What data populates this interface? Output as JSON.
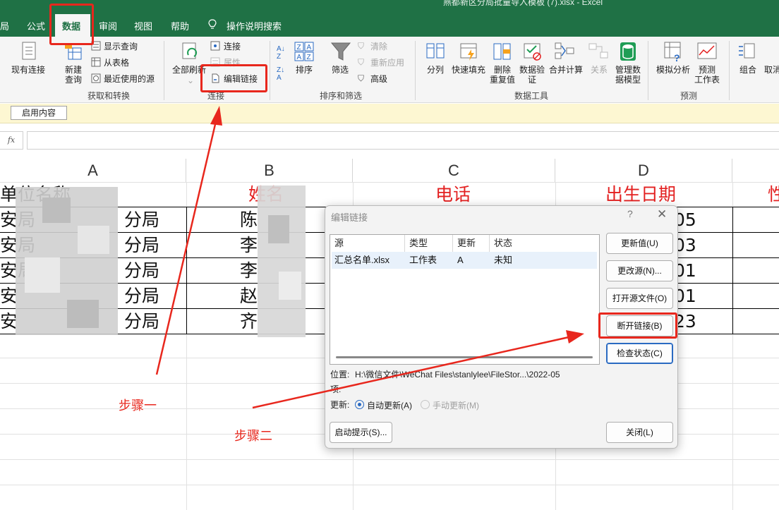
{
  "window": {
    "title": "燕都新区分局批量导入模板 (7).xlsx  -  Excel"
  },
  "menu_tabs": [
    "局",
    "公式",
    "数据",
    "审阅",
    "视图",
    "帮助"
  ],
  "search_label": "操作说明搜索",
  "ribbon": {
    "get_transform": {
      "existing_connections": "现有连接",
      "new_query_1": "新建",
      "new_query_2": "查询",
      "show_queries": "显示查询",
      "from_table": "从表格",
      "recent_sources": "最近使用的源",
      "group_label": "获取和转换"
    },
    "connections": {
      "refresh_all": "全部刷新",
      "connections": "连接",
      "properties": "属性",
      "edit_links": "编辑链接",
      "group_label": "连接"
    },
    "sort_filter": {
      "sort": "排序",
      "filter": "筛选",
      "clear": "清除",
      "reapply": "重新应用",
      "advanced": "高级",
      "group_label": "排序和筛选"
    },
    "data_tools": {
      "text_to_columns": "分列",
      "flash_fill": "快速填充",
      "remove_dup_1": "删除",
      "remove_dup_2": "重复值",
      "validation_1": "数据验",
      "validation_2": "证",
      "consolidate": "合并计算",
      "relationships": "关系",
      "manage_model_1": "管理数",
      "manage_model_2": "据模型",
      "group_label": "数据工具"
    },
    "forecast": {
      "what_if": "模拟分析",
      "forecast_sheet_1": "预测",
      "forecast_sheet_2": "工作表",
      "group_label": "预测"
    },
    "outline": {
      "group": "组合",
      "ungroup": "取消"
    }
  },
  "security_bar": {
    "enable_button": "启用内容"
  },
  "formula_bar": {
    "fx": "fx",
    "value": ""
  },
  "sheet": {
    "columns": [
      "A",
      "B",
      "C",
      "D"
    ],
    "headers": [
      "单位名称",
      "姓名",
      "电话",
      "出生日期",
      "性"
    ],
    "rows": [
      {
        "a_start": "安局",
        "a_end": "分局",
        "b": "陈",
        "d": "05"
      },
      {
        "a_start": "安局",
        "a_end": "分局",
        "b": "李",
        "d": "03"
      },
      {
        "a_start": "安局",
        "a_end": "分局",
        "b": "李",
        "d": "01"
      },
      {
        "a_start": "安",
        "a_end": "分局",
        "b": "赵",
        "d": "01"
      },
      {
        "a_start": "安",
        "a_end": "分局",
        "b": "齐",
        "d": "23"
      }
    ]
  },
  "dialog": {
    "title": "编辑链接",
    "help": "?",
    "close": "✕",
    "list_headers": [
      "源",
      "类型",
      "更新",
      "状态"
    ],
    "link": {
      "source": "汇总名单.xlsx",
      "type": "工作表",
      "update": "A",
      "status": "未知"
    },
    "buttons": {
      "update_values": "更新值(U)",
      "change_source": "更改源(N)...",
      "open_source": "打开源文件(O)",
      "break_link": "断开链接(B)",
      "check_status": "检查状态(C)",
      "startup_prompt": "启动提示(S)...",
      "close": "关闭(L)"
    },
    "location_label": "位置:",
    "location_value": "H:\\微信文件\\WeChat Files\\stanlylee\\FileStor...\\2022-05",
    "item_label": "项:",
    "update_label": "更新:",
    "auto_update": "自动更新(A)",
    "manual_update": "手动更新(M)",
    "update_mode": "auto"
  },
  "annotations": {
    "step1": "步骤一",
    "step2": "步骤二",
    "color": "#e8271d"
  }
}
